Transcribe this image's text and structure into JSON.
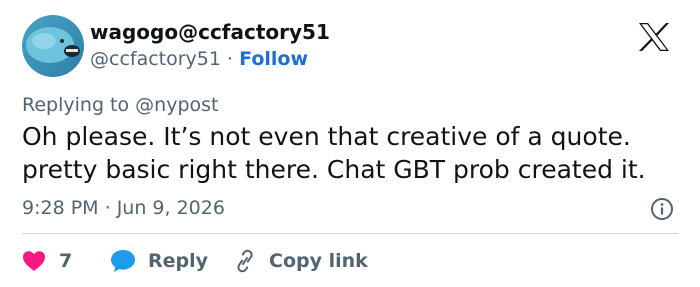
{
  "author": {
    "display_name": "wagogo@ccfactory51",
    "handle": "@ccfactory51",
    "separator": "·",
    "follow_label": "Follow"
  },
  "reply_context": {
    "prefix": "Replying to",
    "mention": "@nypost"
  },
  "tweet": {
    "lines": [
      "Oh please. It’s not even that creative of a quote.",
      "pretty basic right there. Chat GBT prob created it."
    ],
    "time": "9:28 PM",
    "separator": "·",
    "date": "Jun 9, 2026"
  },
  "actions": {
    "like_count": "7",
    "reply_label": "Reply",
    "copy_link_label": "Copy link"
  },
  "icons": {
    "brand": "x-logo-icon",
    "info": "info-icon",
    "like": "heart-icon",
    "reply": "speech-bubble-icon",
    "copy": "link-icon"
  },
  "colors": {
    "text": "#0f1419",
    "secondary": "#536471",
    "follow": "#1d6fd4",
    "heart": "#f91880",
    "reply_bubble": "#1d9bf0",
    "divider": "#cfd9de"
  }
}
